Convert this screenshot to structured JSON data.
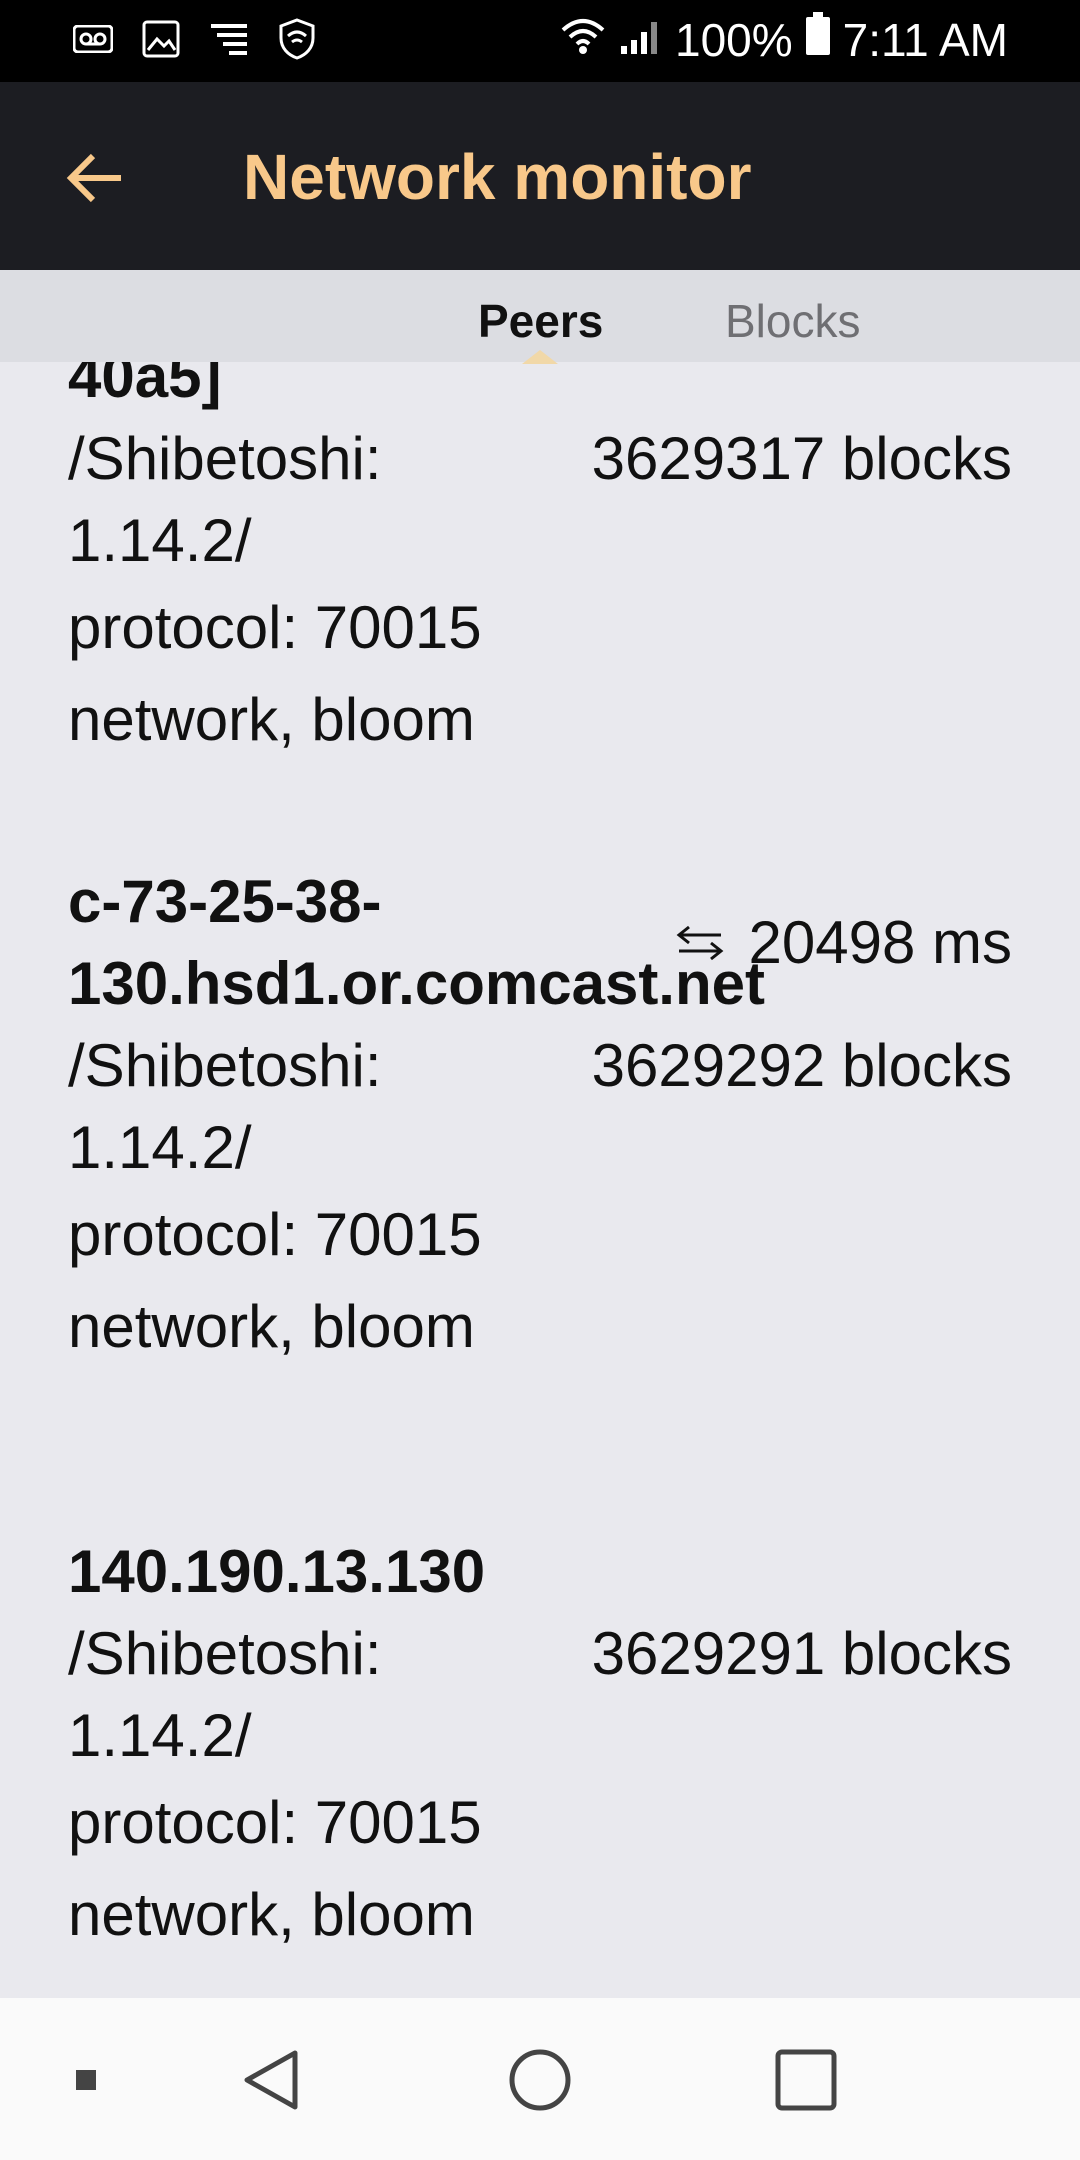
{
  "status_bar": {
    "icons_left": [
      "voicemail-icon",
      "image-icon",
      "data-signal-icon",
      "shield-icon"
    ],
    "battery": "100%",
    "time": "7:11 AM"
  },
  "app_bar": {
    "title": "Network monitor",
    "back_icon": "arrow-back-icon"
  },
  "tabs": [
    {
      "label": "Peers",
      "active": true
    },
    {
      "label": "Blocks",
      "active": false
    }
  ],
  "peers": [
    {
      "host": "40a5]",
      "agent": "/Shibetoshi: 1.14.2/",
      "height": "3629317 blocks",
      "protocol": "protocol: 70015",
      "services": "network, bloom"
    },
    {
      "host": "c-73-25-38-130.hsd1.or.comcast.net",
      "ping": "20498 ms",
      "agent": "/Shibetoshi: 1.14.2/",
      "height": "3629292 blocks",
      "protocol": "protocol: 70015",
      "services": "network, bloom"
    },
    {
      "host": "140.190.13.130",
      "agent": "/Shibetoshi: 1.14.2/",
      "height": "3629291 blocks",
      "protocol": "protocol: 70015",
      "services": "network, bloom"
    }
  ],
  "colors": {
    "accent": "#f8c88a",
    "app_bar": "#1c1d22",
    "background": "#e9e9ee"
  }
}
